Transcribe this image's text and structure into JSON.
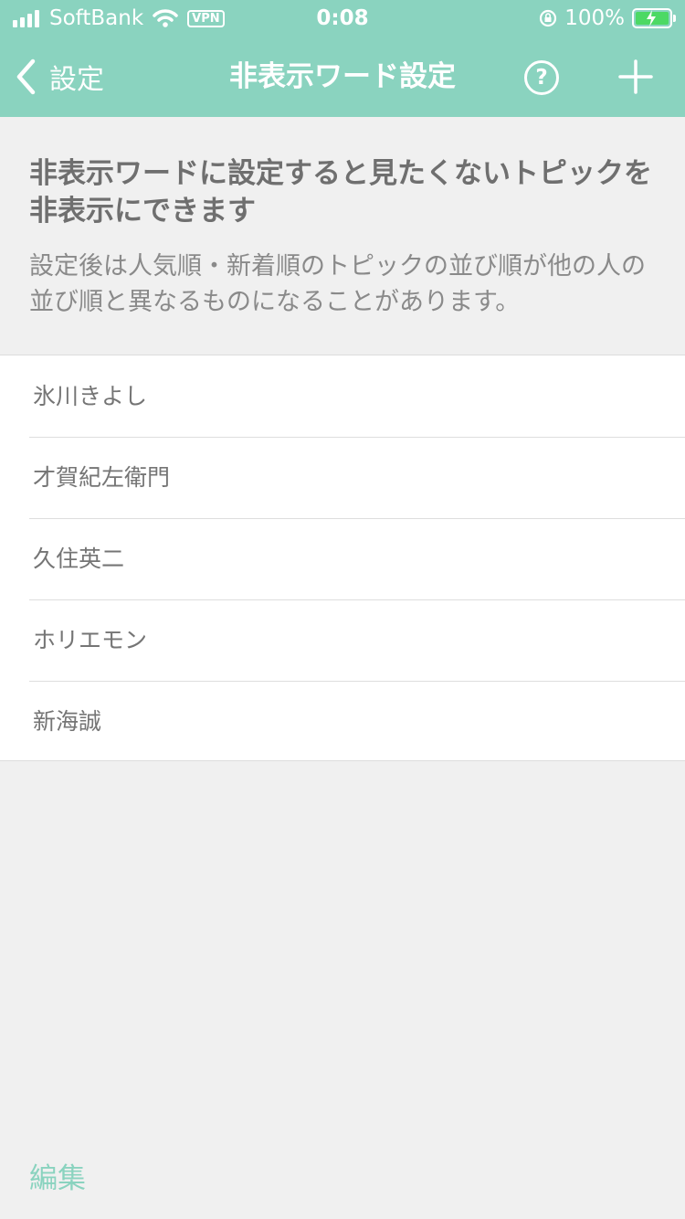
{
  "status_bar": {
    "carrier": "SoftBank",
    "vpn": "VPN",
    "time": "0:08",
    "battery": "100%"
  },
  "nav": {
    "back_label": "設定",
    "title": "非表示ワード設定",
    "help_label": "?"
  },
  "intro": {
    "heading": "非表示ワードに設定すると見たくないトピックを非表示にできます",
    "text": "設定後は人気順・新着順のトピックの並び順が他の人の並び順と異なるものになることがあります。"
  },
  "words": [
    "氷川きよし",
    "才賀紀左衛門",
    "久住英二",
    "ホリエモン",
    "新海誠"
  ],
  "footer": {
    "edit_label": "編集"
  },
  "colors": {
    "accent": "#8ad3bf",
    "background": "#f0f0f0"
  }
}
